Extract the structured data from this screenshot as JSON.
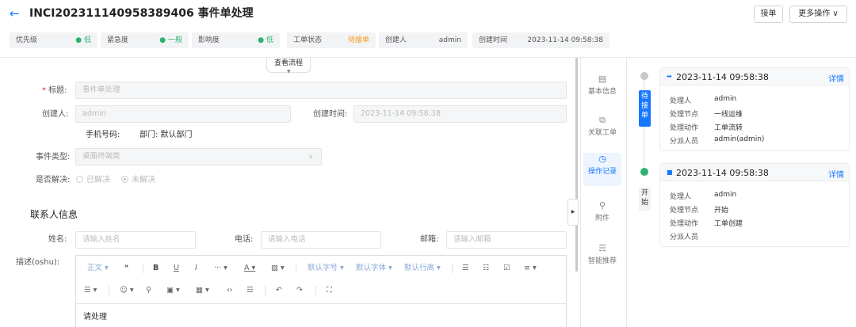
{
  "header": {
    "back_icon": "←",
    "title": "INCI20231114095838940​6 事件单处理",
    "accept_label": "接单",
    "more_label": "更多操作 ∨"
  },
  "chips": [
    {
      "key": "优先级",
      "value": "● 低",
      "color": "green"
    },
    {
      "key": "紧急度",
      "value": "● 一般",
      "color": "green"
    },
    {
      "key": "影响度",
      "value": "● 低",
      "color": "green"
    },
    {
      "key": "工单状态",
      "value": "待接单",
      "color": "orange"
    },
    {
      "key": "创建人",
      "value": "admin",
      "color": ""
    },
    {
      "key": "创建时间",
      "value": "2023-11-14 09:58:38",
      "color": ""
    }
  ],
  "flow_button": "查看流程",
  "form": {
    "title_label": "标题:",
    "title_required": "*",
    "title_value": "事件单处理",
    "creator_label": "创建人:",
    "creator_value": "admin",
    "create_time_label": "创建时间:",
    "create_time_value": "2023-11-14 09:58:38",
    "phone_text": "手机号码:",
    "dept_text": "部门: 默认部门",
    "event_type_label": "事件类型:",
    "event_type_value": "桌面终端类",
    "resolved_label": "是否解决:",
    "resolved_yes": "已解决",
    "resolved_no": "未解决",
    "contact_section": "联系人信息",
    "name_label": "姓名:",
    "name_placeholder": "请输入姓名",
    "phone_label": "电话:",
    "phone_placeholder": "请输入电话",
    "email_label": "邮箱:",
    "email_placeholder": "请输入邮箱",
    "desc_label": "描述(oshu):",
    "desc_content": "请处理"
  },
  "editor_toolbar": {
    "row1": [
      "正文 ▾",
      "❝",
      "B",
      "U",
      "I",
      "··· ▾",
      "A ▾",
      "▨ ▾",
      "默认字号 ▾",
      "默认字体 ▾",
      "默认行高 ▾",
      "☰",
      "☷",
      "☑",
      "≡ ▾"
    ],
    "row2": [
      "☰ ▾",
      "☺ ▾",
      "⚲",
      "▣ ▾",
      "▦ ▾",
      "‹›",
      "☲",
      "↶",
      "↷",
      "⛶"
    ]
  },
  "side_tabs": [
    {
      "label": "基本信息",
      "icon": "▤"
    },
    {
      "label": "关联工单",
      "icon": "⧉"
    },
    {
      "label": "操作记录",
      "icon": "◷"
    },
    {
      "label": "附件",
      "icon": "⚲"
    },
    {
      "label": "智能推荐",
      "icon": "☴"
    }
  ],
  "timeline": [
    {
      "stage": "待接单",
      "time": "2023-11-14 09:58:38",
      "detail": "详情",
      "rows": [
        {
          "k": "处理人",
          "v": "admin"
        },
        {
          "k": "处理节点",
          "v": "一线运维"
        },
        {
          "k": "处理动作",
          "v": "工单流转"
        },
        {
          "k": "分派人员",
          "v": "admin(admin)"
        }
      ]
    },
    {
      "stage": "开始",
      "time": "2023-11-14 09:58:38",
      "detail": "详情",
      "rows": [
        {
          "k": "处理人",
          "v": "admin"
        },
        {
          "k": "处理节点",
          "v": "开始"
        },
        {
          "k": "处理动作",
          "v": "工单创建"
        },
        {
          "k": "分派人员",
          "v": ""
        }
      ]
    }
  ],
  "colors": {
    "accent": "#1677ff",
    "green": "#2db36f",
    "orange": "#fa9b14"
  }
}
